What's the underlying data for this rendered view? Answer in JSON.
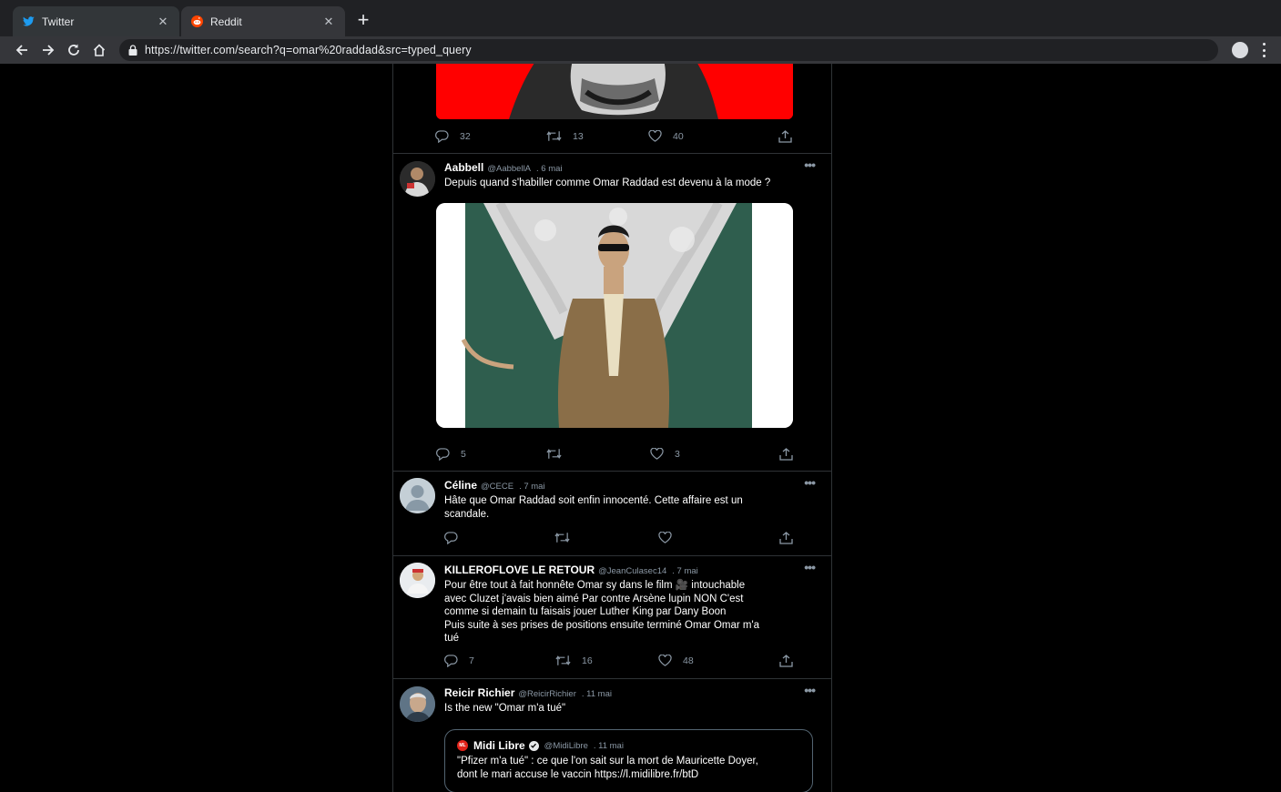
{
  "browser": {
    "tabs": [
      {
        "label": "Twitter",
        "icon": "twitter-bird-icon",
        "active": true
      },
      {
        "label": "Reddit",
        "icon": "reddit-icon",
        "active": false
      }
    ],
    "url": "https://twitter.com/search?q=omar%20raddad&src=typed_query"
  },
  "tweets": [
    {
      "id": "t0",
      "stats": {
        "replies": "32",
        "retweets": "13",
        "likes": "40"
      }
    },
    {
      "id": "t1",
      "name": "Aabbell",
      "handle": "@AabbellA",
      "date": ". 6 mai",
      "text": "Depuis quand s'habiller comme Omar Raddad est devenu à la mode ?",
      "stats": {
        "replies": "5",
        "retweets": "",
        "likes": "3"
      }
    },
    {
      "id": "t2",
      "name": "Céline",
      "handle": "@CECE",
      "date": ". 7 mai",
      "text": "Hâte que Omar Raddad soit enfin innocenté. Cette affaire est un scandale.",
      "stats": {
        "replies": "",
        "retweets": "",
        "likes": ""
      }
    },
    {
      "id": "t3",
      "name": "KILLEROFLOVE LE RETOUR",
      "handle": "@JeanCulasec14",
      "date": ". 7 mai",
      "text_lines": [
        "Pour être tout à fait honnête Omar sy dans le film 🎥 intouchable",
        "avec Cluzet j'avais bien aimé Par contre Arsène lupin NON C'est",
        "comme si demain tu faisais jouer Luther King par Dany Boon",
        "Puis suite à ses prises de positions ensuite terminé Omar Omar m'a",
        "tué"
      ],
      "stats": {
        "replies": "7",
        "retweets": "16",
        "likes": "48"
      }
    },
    {
      "id": "t4",
      "name": "Reicir Richier",
      "handle": "@ReicirRichier",
      "date": ". 11 mai",
      "text": "Is the new \"Omar m'a tué\"",
      "quote": {
        "logo": "ML",
        "name": "Midi Libre",
        "handle": "@MidiLibre",
        "date": ". 11 mai",
        "text_lines": [
          "\"Pfizer m'a tué\" : ce que l'on sait sur la mort de Mauricette Doyer,",
          "dont le mari accuse le vaccin https://l.midilibre.fr/btD"
        ]
      }
    }
  ],
  "more_label": "•••",
  "colors": {
    "accent_red": "#ff0000",
    "twitter_blue": "#1d9bf0",
    "muted": "#8b98a5"
  }
}
